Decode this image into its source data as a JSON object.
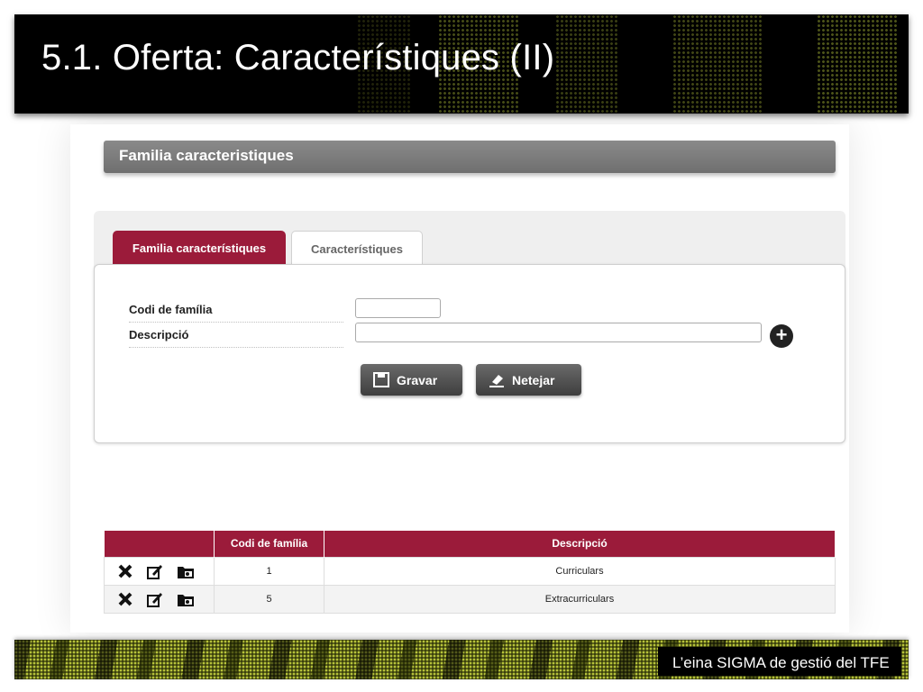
{
  "slide": {
    "title": "5.1. Oferta: Característiques (II)",
    "footer": "L’eina SIGMA de gestió del TFE"
  },
  "section": {
    "title": "Familia caracteristiques"
  },
  "tabs": [
    {
      "label": "Familia característiques",
      "active": true
    },
    {
      "label": "Característiques",
      "active": false
    }
  ],
  "form": {
    "codi_label": "Codi de família",
    "codi_value": "",
    "desc_label": "Descripció",
    "desc_value": "",
    "add_icon": "plus-circle-icon",
    "save_label": "Gravar",
    "save_icon": "floppy-disk-icon",
    "clear_label": "Netejar",
    "clear_icon": "eraser-icon"
  },
  "table": {
    "headers": [
      "",
      "Codi de família",
      "Descripció"
    ],
    "action_icons": [
      "delete-icon",
      "edit-icon",
      "open-folder-icon"
    ],
    "rows": [
      {
        "codi": "1",
        "descripcio": "Curriculars"
      },
      {
        "codi": "5",
        "descripcio": "Extracurriculars"
      }
    ]
  },
  "colors": {
    "accent": "#9b1b3a",
    "header_bg": "#000000",
    "section_bar": "#7a7a7a",
    "button": "#4a4a4a",
    "footer_green": "#8e9a2a"
  }
}
